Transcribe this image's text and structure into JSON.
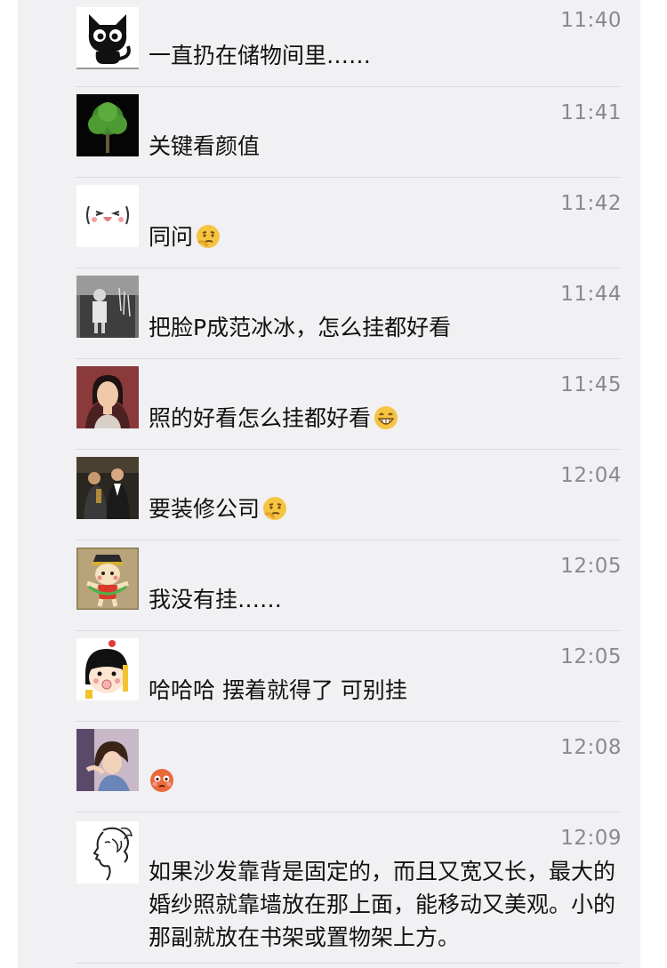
{
  "comments": [
    {
      "time": "11:40",
      "text": "一直扔在储物间里……",
      "avatar_icon": "black-cat-avatar"
    },
    {
      "time": "11:41",
      "text": "关键看颜值",
      "avatar_icon": "tree-avatar"
    },
    {
      "time": "11:42",
      "text": "同问",
      "avatar_icon": "cute-face-avatar",
      "emoji_icon": "thinking-emoji"
    },
    {
      "time": "11:44",
      "text": "把脸P成范冰冰，怎么挂都好看",
      "avatar_icon": "old-photo-avatar"
    },
    {
      "time": "11:45",
      "text": "照的好看怎么挂都好看",
      "avatar_icon": "woman-portrait-avatar",
      "emoji_icon": "grinning-emoji"
    },
    {
      "time": "12:04",
      "text": "要装修公司",
      "avatar_icon": "group-photo-avatar",
      "emoji_icon": "thinking-emoji"
    },
    {
      "time": "12:05",
      "text": "我没有挂……",
      "avatar_icon": "cartoon-boy-avatar"
    },
    {
      "time": "12:05",
      "text": "哈哈哈 摆着就得了 可别挂",
      "avatar_icon": "cartoon-girl-avatar"
    },
    {
      "time": "12:08",
      "text": "",
      "avatar_icon": "woman-photo-avatar",
      "emoji_icon": "flushed-emoji"
    },
    {
      "time": "12:09",
      "text": "如果沙发靠背是固定的，而且又宽又长，最大的婚纱照就靠墙放在那上面，能移动又美观。小的那副就放在书架或置物架上方。",
      "avatar_icon": "line-drawing-woman-avatar"
    }
  ],
  "colors": {
    "panel_bg": "#f1f1f3",
    "divider": "#dcdcde",
    "time_text": "#8a8a8e",
    "body_text": "#111111"
  }
}
